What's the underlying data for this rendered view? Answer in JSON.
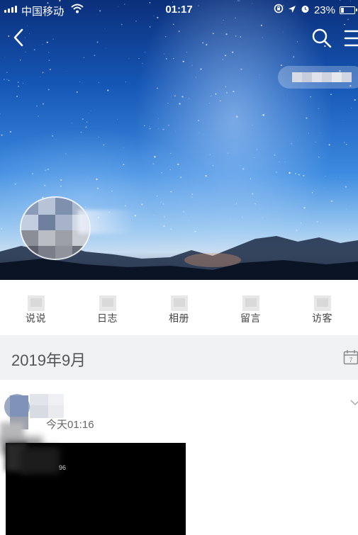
{
  "status_bar": {
    "carrier": "中国移动",
    "time": "01:17",
    "battery": "23%",
    "battery_level": 0.23
  },
  "header": {
    "back_icon": "back-chevron-icon",
    "search_icon": "search-icon",
    "menu_icon": "menu-icon"
  },
  "tabs": [
    {
      "label": "说说",
      "icon": "shuoshuo-icon"
    },
    {
      "label": "日志",
      "icon": "diary-icon"
    },
    {
      "label": "相册",
      "icon": "album-icon"
    },
    {
      "label": "留言",
      "icon": "message-board-icon"
    },
    {
      "label": "访客",
      "icon": "visitor-icon"
    }
  ],
  "timeline": {
    "month": "2019年9月",
    "calendar_icon": "calendar-icon",
    "calendar_day": "7"
  },
  "post": {
    "time": "今天01:16",
    "media_caption": "96",
    "expand_icon": "chevron-down-icon"
  }
}
